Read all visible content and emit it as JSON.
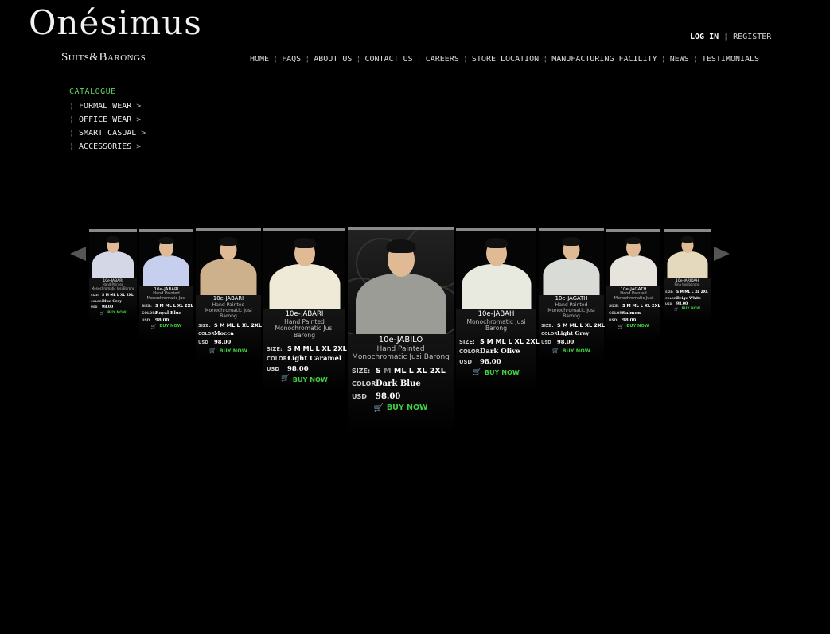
{
  "brand": {
    "name": "Onésimus",
    "tagline": "Suits&Barongs"
  },
  "auth": {
    "login": "LOG IN",
    "separator": "¦",
    "register": "REGISTER"
  },
  "nav": {
    "items": [
      "HOME",
      "FAQS",
      "ABOUT US",
      "CONTACT US",
      "CAREERS",
      "STORE LOCATION",
      "MANUFACTURING FACILITY",
      "NEWS",
      "TESTIMONIALS"
    ],
    "separator": "¦"
  },
  "catalogue": {
    "title": "CATALOGUE",
    "items": [
      "FORMAL WEAR",
      "OFFICE WEAR",
      "SMART CASUAL",
      "ACCESSORIES"
    ],
    "bar": "¦",
    "chevron": ">"
  },
  "carousel": {
    "prev_icon": "arrow-left-icon",
    "next_icon": "arrow-right-icon",
    "labels": {
      "size": "SIZE:",
      "color": "COLOR:",
      "usd": "USD",
      "buy": "BUY NOW"
    },
    "products": [
      {
        "code": "10e-JABARI",
        "desc": "Hand Painted Monochromatic Jusi Barong",
        "sizes": "S M ML L XL 2XL",
        "color": "Blue Grey",
        "price": "98.00",
        "shirt": "#d4d8e6"
      },
      {
        "code": "10e-JABARI",
        "desc": "Hand Painted Monochromatic Jusi",
        "sizes": "S M ML L XL 2XL",
        "color": "Royal Blue",
        "price": "98.00",
        "shirt": "#c6d0ee"
      },
      {
        "code": "10e-JABARI",
        "desc": "Hand Painted Monochromatic Jusi Barong",
        "sizes": "S M ML L XL 2XL",
        "color": "Mocca",
        "price": "98.00",
        "shirt": "#cdb08c"
      },
      {
        "code": "10e-JABARI",
        "desc": "Hand Painted Monochromatic Jusi Barong",
        "sizes": "S M ML L XL 2XL",
        "color": "Light Caramel",
        "price": "98.00",
        "shirt": "#efe9d8"
      },
      {
        "code": "10e-JABILO",
        "desc": "Hand Painted Monochromatic Jusi Barong",
        "sizes_pre": "S",
        "sizes_mid": "M",
        "sizes_post": "ML L XL 2XL",
        "color": "Dark Blue",
        "price": "98.00",
        "shirt": "#9b9c96"
      },
      {
        "code": "10e-JABAH",
        "desc": "Monochromatic Jusi Barong",
        "sizes": "S M ML L XL 2XL",
        "color": "Dark Olive",
        "price": "98.00",
        "shirt": "#e8eae0"
      },
      {
        "code": "10e-JAGATH",
        "desc": "Hand Painted Monochromatic Jusi Barong",
        "sizes": "S M ML L XL 2XL",
        "color": "Light Grey",
        "price": "98.00",
        "shirt": "#d9dbd6"
      },
      {
        "code": "10e-JAGATH",
        "desc": "Hand Painted Monochromatic Jusi",
        "sizes": "S M ML L XL 2XL",
        "color": "Salmon",
        "price": "98.00",
        "shirt": "#e6e4dc"
      },
      {
        "code": "10e-JARIDAH",
        "desc": "Pina Jusi barong",
        "sizes": "S M ML L XL 2XL",
        "color": "Beige White",
        "price": "98.00",
        "shirt": "#e4d9bd"
      }
    ]
  }
}
